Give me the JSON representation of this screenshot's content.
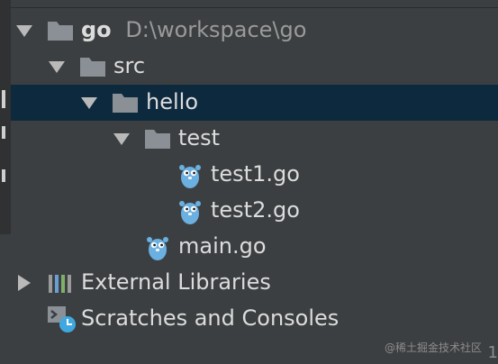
{
  "tree": {
    "root_name": "go",
    "root_path": "D:\\workspace\\go",
    "src": "src",
    "hello": "hello",
    "test": "test",
    "test1": "test1.go",
    "test2": "test2.go",
    "main": "main.go",
    "external_libraries": "External Libraries",
    "scratches": "Scratches and Consoles"
  },
  "watermark": "@稀土掘金技术社区",
  "corner_text": "1",
  "colors": {
    "background": "#3c3f41",
    "selection": "#0d293e",
    "folder": "#8a9096",
    "gopher": "#6ab0e0",
    "text": "#dcdcdc"
  }
}
